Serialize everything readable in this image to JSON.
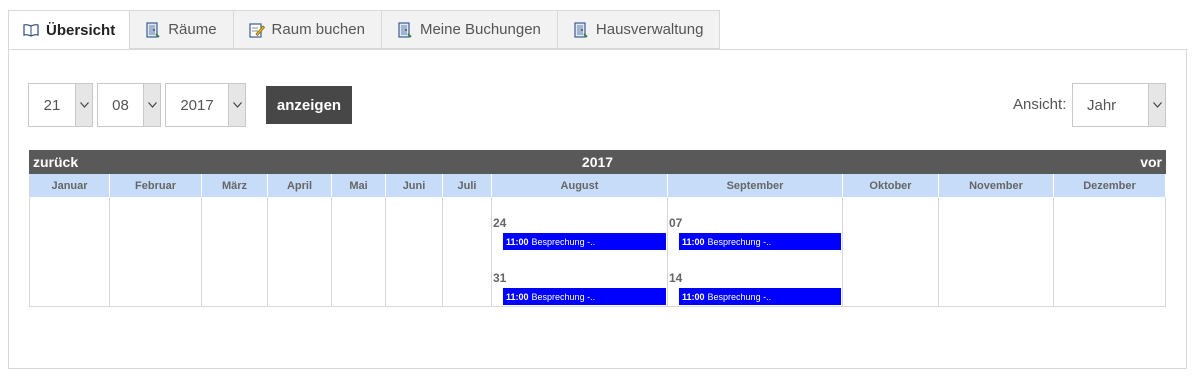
{
  "tabs": [
    {
      "label": "Übersicht",
      "icon": "book-icon",
      "active": true
    },
    {
      "label": "Räume",
      "icon": "door-icon",
      "active": false
    },
    {
      "label": "Raum buchen",
      "icon": "edit-icon",
      "active": false
    },
    {
      "label": "Meine Buchungen",
      "icon": "door-icon",
      "active": false
    },
    {
      "label": "Hausverwaltung",
      "icon": "door-icon",
      "active": false
    }
  ],
  "filter": {
    "day": "21",
    "month": "08",
    "year": "2017",
    "show_label": "anzeigen",
    "view_label": "Ansicht:",
    "view_value": "Jahr"
  },
  "calendar": {
    "prev_label": "zurück",
    "year": "2017",
    "next_label": "vor",
    "months": [
      "Januar",
      "Februar",
      "März",
      "April",
      "Mai",
      "Juni",
      "Juli",
      "August",
      "September",
      "Oktober",
      "November",
      "Dezember"
    ],
    "entries": {
      "august": [
        {
          "day": "24",
          "time": "11:00",
          "title": "Besprechung -.."
        },
        {
          "day": "31",
          "time": "11:00",
          "title": "Besprechung -.."
        }
      ],
      "september": [
        {
          "day": "07",
          "time": "11:00",
          "title": "Besprechung -.."
        },
        {
          "day": "14",
          "time": "11:00",
          "title": "Besprechung -.."
        }
      ]
    }
  },
  "colors": {
    "header_bg": "#595959",
    "month_bg": "#c7dcf9",
    "event_bg": "#0000ff",
    "button_bg": "#474747"
  }
}
